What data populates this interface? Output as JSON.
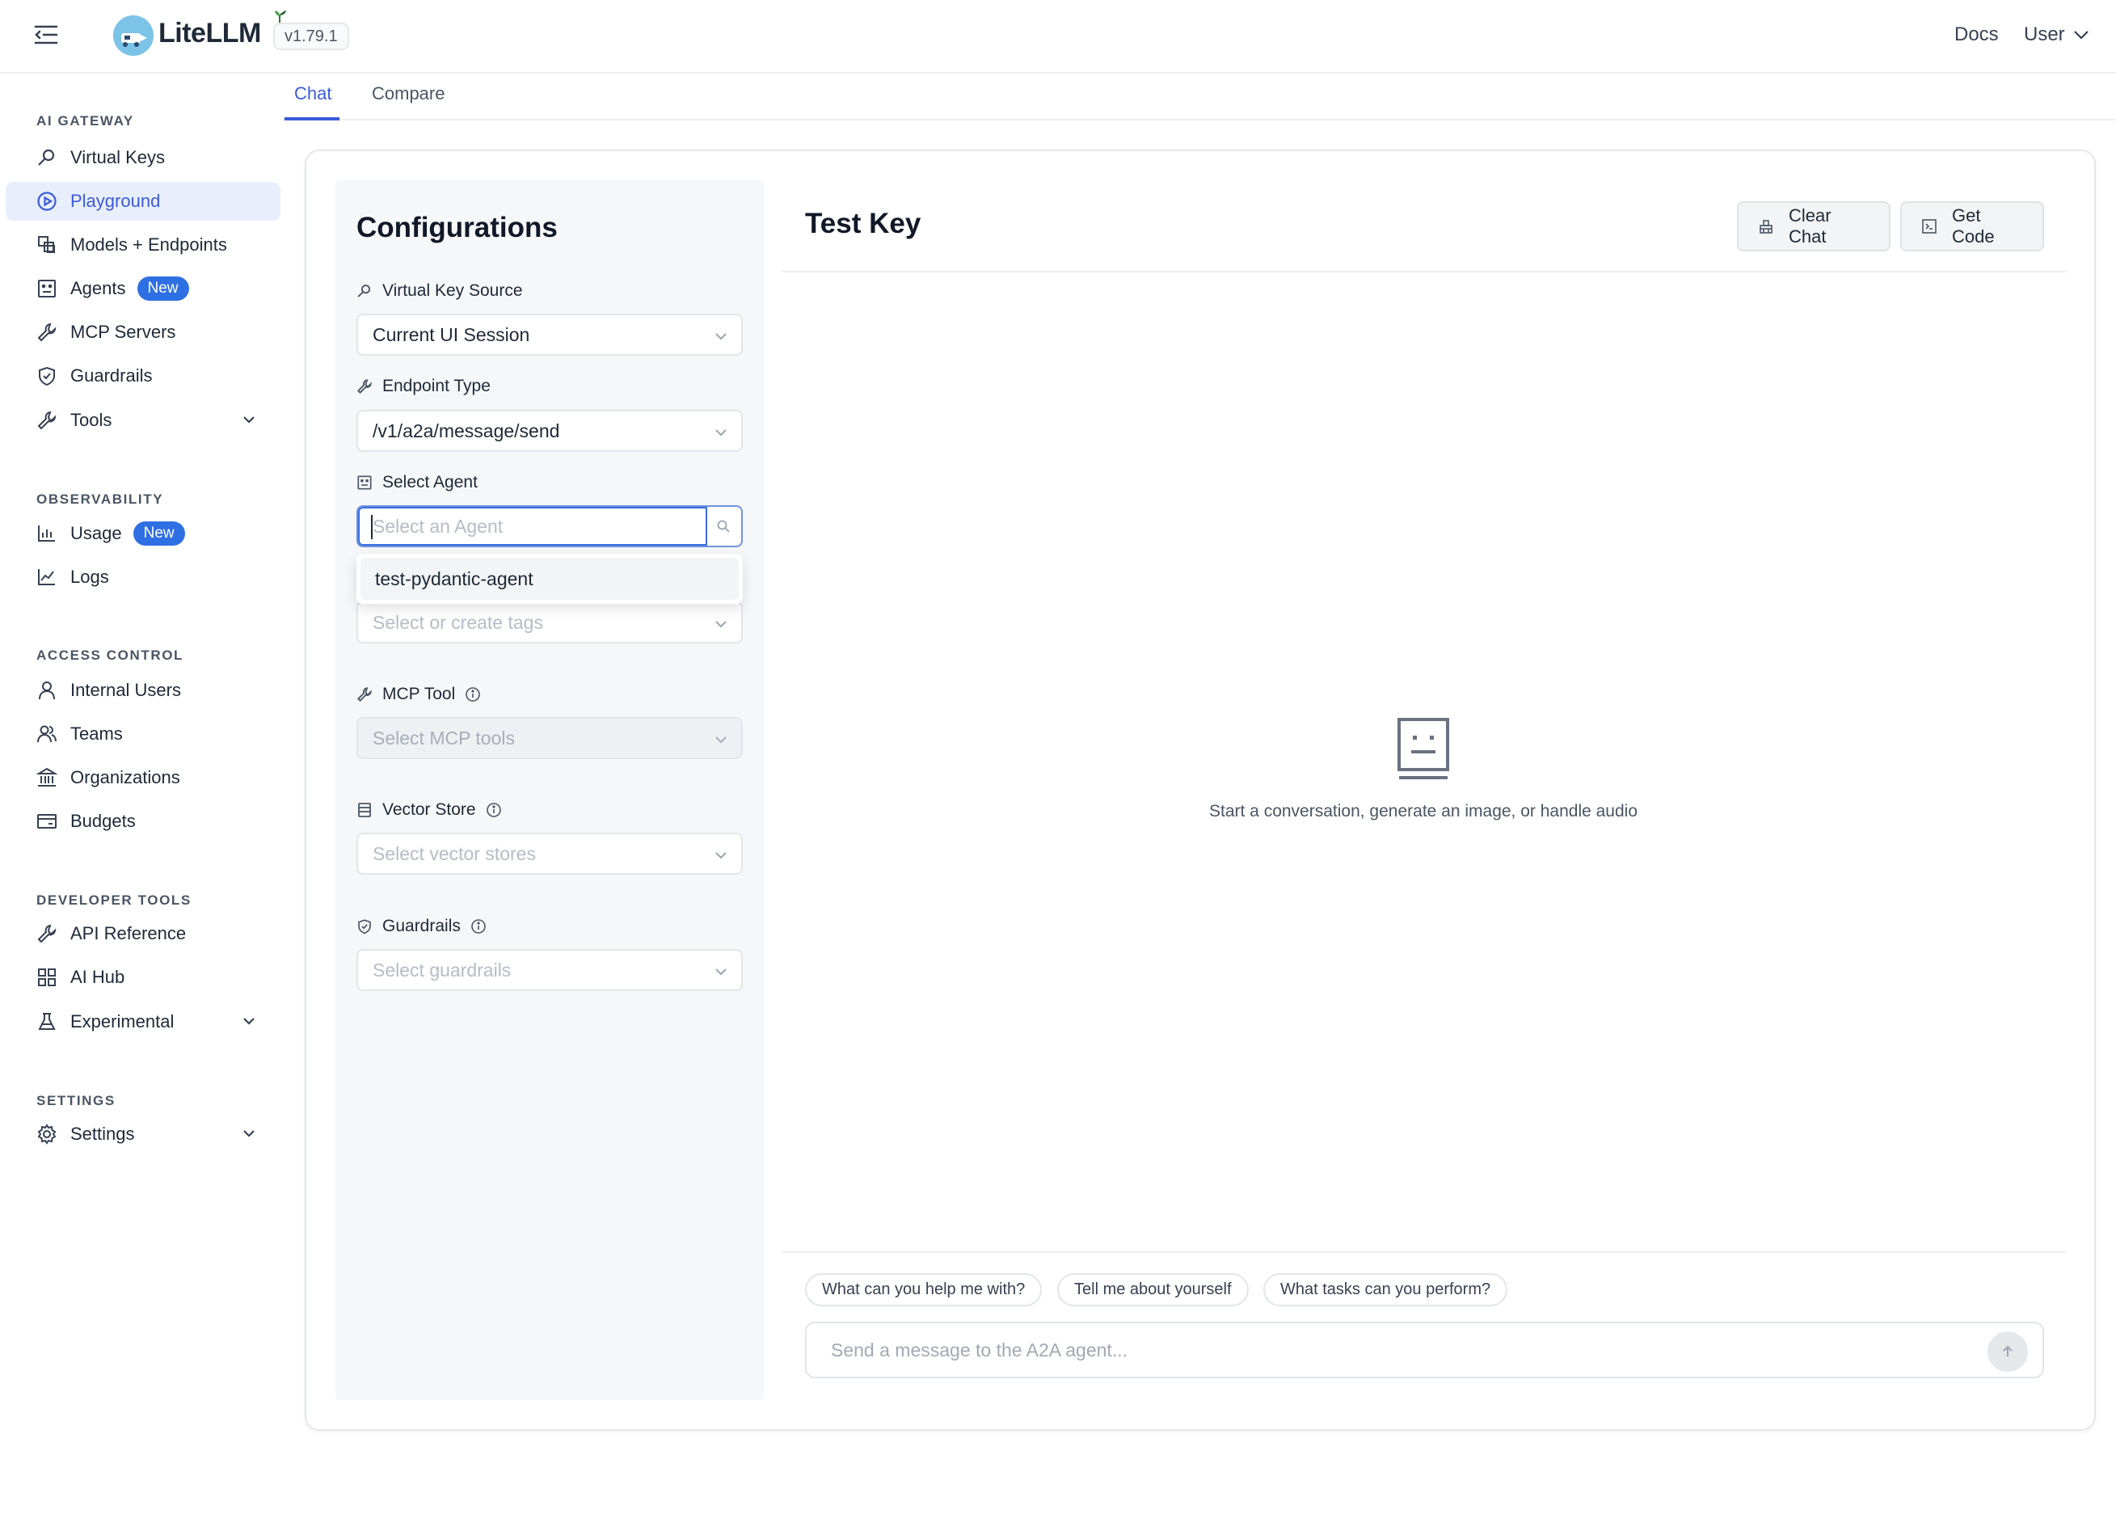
{
  "header": {
    "app_name": "LiteLLM",
    "version": "v1.79.1",
    "docs_label": "Docs",
    "user_label": "User"
  },
  "sidebar": {
    "sections": [
      {
        "label": "AI GATEWAY"
      },
      {
        "label": "OBSERVABILITY"
      },
      {
        "label": "ACCESS CONTROL"
      },
      {
        "label": "DEVELOPER TOOLS"
      },
      {
        "label": "SETTINGS"
      }
    ],
    "items": {
      "virtual_keys": {
        "label": "Virtual Keys",
        "icon": "key-icon"
      },
      "playground": {
        "label": "Playground",
        "icon": "play-circle-icon",
        "active": true
      },
      "models": {
        "label": "Models + Endpoints",
        "icon": "blocks-icon"
      },
      "agents": {
        "label": "Agents",
        "badge": "New",
        "icon": "robot-icon"
      },
      "mcp_servers": {
        "label": "MCP Servers",
        "icon": "wrench-icon"
      },
      "guardrails": {
        "label": "Guardrails",
        "icon": "shield-icon"
      },
      "tools": {
        "label": "Tools",
        "icon": "tool-icon"
      },
      "usage": {
        "label": "Usage",
        "badge": "New",
        "icon": "bar-chart-icon"
      },
      "logs": {
        "label": "Logs",
        "icon": "line-chart-icon"
      },
      "internal_users": {
        "label": "Internal Users",
        "icon": "user-icon"
      },
      "teams": {
        "label": "Teams",
        "icon": "team-icon"
      },
      "organizations": {
        "label": "Organizations",
        "icon": "bank-icon"
      },
      "budgets": {
        "label": "Budgets",
        "icon": "credit-card-icon"
      },
      "api_reference": {
        "label": "API Reference",
        "icon": "api-icon"
      },
      "ai_hub": {
        "label": "AI Hub",
        "icon": "grid-icon"
      },
      "experimental": {
        "label": "Experimental",
        "icon": "flask-icon"
      },
      "settings": {
        "label": "Settings",
        "icon": "gear-icon"
      }
    }
  },
  "tabs": {
    "chat": "Chat",
    "compare": "Compare"
  },
  "config": {
    "title": "Configurations",
    "virtual_key_source": {
      "label": "Virtual Key Source",
      "value": "Current UI Session"
    },
    "endpoint_type": {
      "label": "Endpoint Type",
      "value": "/v1/a2a/message/send"
    },
    "select_agent": {
      "label": "Select Agent",
      "placeholder": "Select an Agent",
      "options": [
        "test-pydantic-agent"
      ]
    },
    "tags": {
      "placeholder": "Select or create tags"
    },
    "mcp_tool": {
      "label": "MCP Tool",
      "placeholder": "Select MCP tools"
    },
    "vector_store": {
      "label": "Vector Store",
      "placeholder": "Select vector stores"
    },
    "guardrails": {
      "label": "Guardrails",
      "placeholder": "Select guardrails"
    }
  },
  "chat": {
    "title": "Test Key",
    "clear_label": "Clear Chat",
    "code_label": "Get Code",
    "empty_text": "Start a conversation, generate an image, or handle audio",
    "suggestions": [
      "What can you help me with?",
      "Tell me about yourself",
      "What tasks can you perform?"
    ],
    "input_placeholder": "Send a message to the A2A agent..."
  },
  "colors": {
    "accent": "#3b5bdb",
    "active_bg": "#e8eefc",
    "badge": "#2f6fe4"
  }
}
